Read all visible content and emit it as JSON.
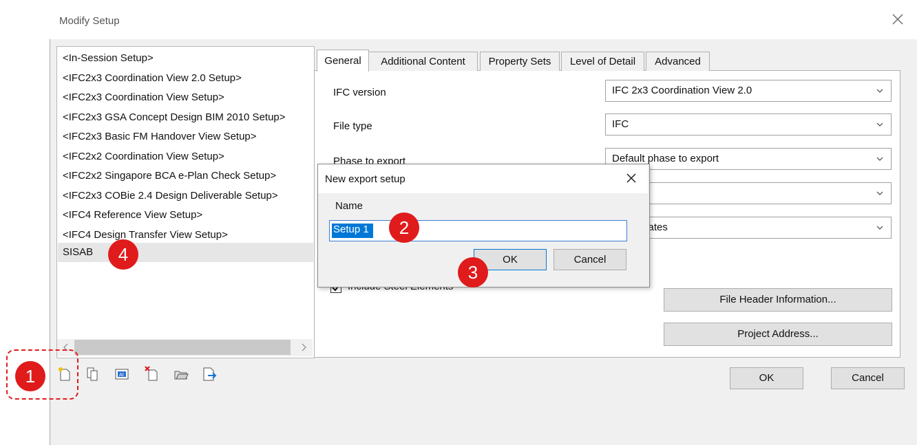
{
  "window": {
    "title": "Modify Setup"
  },
  "setups": [
    "<In-Session Setup>",
    "<IFC2x3 Coordination View 2.0 Setup>",
    "<IFC2x3 Coordination View Setup>",
    "<IFC2x3 GSA Concept Design BIM 2010 Setup>",
    "<IFC2x3 Basic FM Handover View Setup>",
    "<IFC2x2 Coordination View Setup>",
    "<IFC2x2 Singapore BCA e-Plan Check Setup>",
    "<IFC2x3 COBie 2.4 Design Deliverable Setup>",
    "<IFC4 Reference View Setup>",
    "<IFC4 Design Transfer View Setup>",
    "SISAB"
  ],
  "tabs": [
    "General",
    "Additional Content",
    "Property Sets",
    "Level of Detail",
    "Advanced"
  ],
  "general": {
    "ifc_version_label": "IFC version",
    "ifc_version_value": "IFC 2x3 Coordination View 2.0",
    "file_type_label": "File type",
    "file_type_value": "IFC",
    "phase_label": "Phase to export",
    "phase_value": "Default phase to export",
    "fourth_value": "",
    "coordinates_value": "Coordinates",
    "steel_checkbox_label": "Include Steel Elements",
    "file_header_button": "File Header Information...",
    "project_address_button": "Project Address..."
  },
  "footer": {
    "ok": "OK",
    "cancel": "Cancel"
  },
  "popup": {
    "title": "New export setup",
    "name_label": "Name",
    "name_value": "Setup 1",
    "ok": "OK",
    "cancel": "Cancel"
  },
  "callouts": [
    "1",
    "2",
    "3",
    "4"
  ],
  "toolbar_icons": [
    "new-setup-icon",
    "duplicate-setup-icon",
    "rename-setup-icon",
    "delete-setup-icon",
    "import-setup-icon",
    "export-setup-icon"
  ],
  "colors": {
    "callout": "#e01b1b",
    "selection": "#0078d7"
  }
}
